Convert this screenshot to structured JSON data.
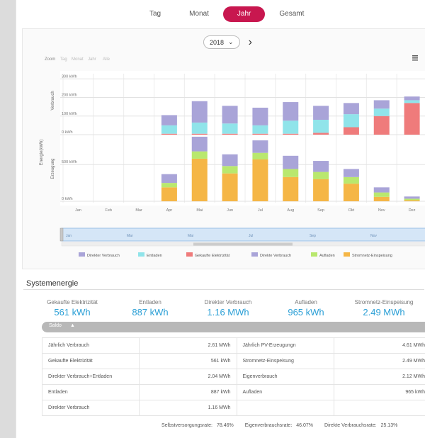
{
  "tabs": [
    {
      "label": "Tag",
      "active": false
    },
    {
      "label": "Monat",
      "active": false
    },
    {
      "label": "Jahr",
      "active": true
    },
    {
      "label": "Gesamt",
      "active": false
    }
  ],
  "year_selector": {
    "value": "2018"
  },
  "chart_toolbar": {
    "zoom_label": "Zoom",
    "options": [
      "Tag",
      "Monat",
      "Jahr",
      "Alle"
    ]
  },
  "chart_data": {
    "type": "bar",
    "categories": [
      "Jan",
      "Feb",
      "Mar",
      "Apr",
      "Mai",
      "Jun",
      "Jul",
      "Aug",
      "Sep",
      "Okt",
      "Nov",
      "Dez"
    ],
    "ylabel": "Energie(kWh)",
    "panels": [
      {
        "name": "Verbrauch",
        "ticks": [
          "0 kWh",
          "100 kWh",
          "200 kWh",
          "300 kWh"
        ],
        "ylim": [
          0,
          320
        ],
        "series": [
          {
            "name": "Gekaufte Elektrizität",
            "color": "#ef7b7b",
            "values": [
              0,
              0,
              0,
              5,
              5,
              5,
              5,
              5,
              10,
              40,
              100,
              170
            ]
          },
          {
            "name": "Entladen",
            "color": "#90e4ea",
            "values": [
              0,
              0,
              0,
              45,
              60,
              55,
              45,
              70,
              70,
              70,
              40,
              15
            ]
          },
          {
            "name": "Direkter Verbrauch",
            "color": "#a9a4d8",
            "values": [
              0,
              0,
              0,
              55,
              115,
              95,
              95,
              100,
              75,
              60,
              45,
              20
            ]
          }
        ]
      },
      {
        "name": "Erzeugung",
        "ticks": [
          "0 kWh",
          "500 kWh"
        ],
        "ylim": [
          0,
          850
        ],
        "series": [
          {
            "name": "Stromnetz-Einspeisung",
            "color": "#f5b646",
            "values": [
              0,
              0,
              0,
              190,
              580,
              380,
              570,
              330,
              300,
              240,
              60,
              15
            ]
          },
          {
            "name": "Aufladen",
            "color": "#b9e86e",
            "values": [
              0,
              0,
              0,
              60,
              100,
              100,
              90,
              110,
              100,
              90,
              60,
              20
            ]
          },
          {
            "name": "Direkte Verbrauch",
            "color": "#a9a4d8",
            "values": [
              0,
              0,
              0,
              120,
              200,
              160,
              170,
              180,
              150,
              110,
              70,
              30
            ]
          }
        ]
      }
    ],
    "navigator": {
      "labels": [
        "Jan",
        "Mar",
        "Mai",
        "Jul",
        "Sep",
        "Nov"
      ]
    },
    "legend": [
      {
        "name": "Direkter Verbrauch",
        "color": "#a9a4d8"
      },
      {
        "name": "Entladen",
        "color": "#90e4ea"
      },
      {
        "name": "Gekaufte Elektrizität",
        "color": "#ef7b7b"
      },
      {
        "name": "Direkte Verbrauch",
        "color": "#a9a4d8"
      },
      {
        "name": "Aufladen",
        "color": "#b9e86e"
      },
      {
        "name": "Stromnetz-Einspeisung",
        "color": "#f5b646"
      }
    ],
    "legend_position": "bottom"
  },
  "systemenergie": {
    "title": "Systemenergie",
    "kpis": [
      {
        "label": "Gekaufte Elektrizität",
        "value": "561 kWh"
      },
      {
        "label": "Entladen",
        "value": "887 kWh"
      },
      {
        "label": "Direkter Verbrauch",
        "value": "1.16 MWh"
      },
      {
        "label": "Aufladen",
        "value": "965 kWh"
      },
      {
        "label": "Stromnetz-Einspeisung",
        "value": "2.49 MWh"
      }
    ],
    "saldo_label": "Saldo",
    "table": [
      [
        "Jährlich Verbrauch",
        "2.61 MWh",
        "Jährlich PV-Erzeugungn",
        "4.61 MWh"
      ],
      [
        "Gekaufte Elektrizität",
        "561 kWh",
        "Stromnetz-Einspeisung",
        "2.49 MWh"
      ],
      [
        "Direkter Verbrauch+Entladen",
        "2.04 MWh",
        "Eigenverbrauch",
        "2.12 MWh"
      ],
      [
        "Entladen",
        "887 kWh",
        "Aufladen",
        "965 kWh"
      ],
      [
        "Direkter Verbrauch",
        "1.16 MWh",
        "",
        ""
      ]
    ],
    "rates": [
      {
        "label": "Selbstversorgungsrate:",
        "value": "78.46%"
      },
      {
        "label": "Eigenverbrauchsrate:",
        "value": "46.07%"
      },
      {
        "label": "Direkte Verbrauchsrate:",
        "value": "25.13%"
      }
    ]
  }
}
